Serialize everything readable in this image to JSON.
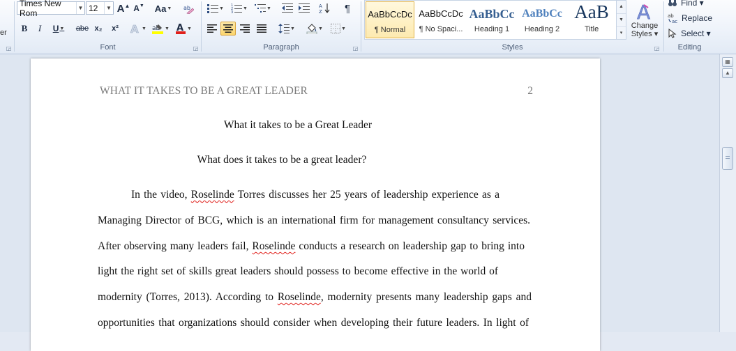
{
  "ribbon": {
    "clipboard": {
      "partial_label": "er"
    },
    "font": {
      "label": "Font",
      "font_name": "Times New Rom",
      "font_size": "12",
      "grow_glyph": "A",
      "shrink_glyph": "A",
      "change_case_glyph": "Aa",
      "bold": "B",
      "italic": "I",
      "underline": "U",
      "strike": "abe",
      "subscript": "x₂",
      "superscript": "x²"
    },
    "paragraph": {
      "label": "Paragraph",
      "show_marks": "¶"
    },
    "styles": {
      "label": "Styles",
      "items": [
        {
          "sample": "AaBbCcDc",
          "name": "¶ Normal"
        },
        {
          "sample": "AaBbCcDc",
          "name": "¶ No Spaci..."
        },
        {
          "sample": "AaBbCc",
          "name": "Heading 1"
        },
        {
          "sample": "AaBbCc",
          "name": "Heading 2"
        },
        {
          "sample": "AaB",
          "name": "Title"
        }
      ],
      "change_styles_line1": "Change",
      "change_styles_line2": "Styles ▾"
    },
    "editing": {
      "label": "Editing",
      "find": "Find ▾",
      "replace": "Replace",
      "select": "Select ▾"
    }
  },
  "document": {
    "running_head": "WHAT IT TAKES TO BE A GREAT LEADER",
    "page_number": "2",
    "title": "What it takes to be a Great Leader",
    "subtitle": "What does it takes to be a great leader?",
    "lines": [
      {
        "parts": [
          "In the video, ",
          "Roselinde",
          " Torres discusses her 25 years of leadership experience as a"
        ]
      },
      {
        "parts": [
          "Managing Director of BCG, which is an international firm for management consultancy services."
        ]
      },
      {
        "parts": [
          "After observing many leaders fail, ",
          "Roselinde",
          " conducts a research on leadership gap to bring into"
        ]
      },
      {
        "parts": [
          "light the right set of skills great leaders should possess to become effective in the world of"
        ]
      },
      {
        "parts": [
          "modernity (Torres, 2013). According to ",
          "Roselinde",
          ", modernity presents many leadership gaps and"
        ]
      },
      {
        "parts": [
          "opportunities that organizations should consider when developing their future leaders. In light of"
        ]
      }
    ]
  },
  "colors": {
    "ribbon_bg": "#eef3fa",
    "selected_style": "#fbd56e",
    "spellcheck": "#e0201b",
    "heading_blue": "#365f91",
    "font_color_red": "#e0201b",
    "highlight_yellow": "#ffff00"
  }
}
